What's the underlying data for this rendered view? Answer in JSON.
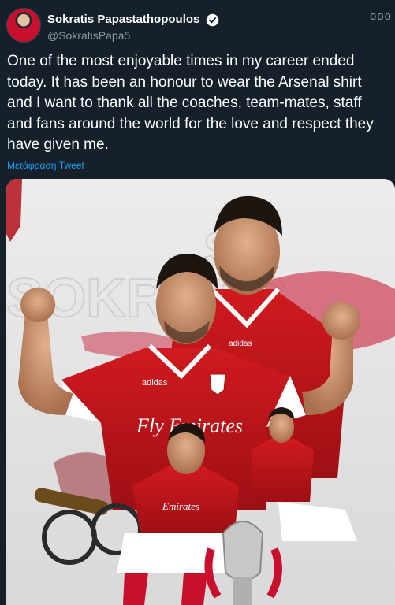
{
  "author": {
    "display_name": "Sokratis Papastathopoulos",
    "handle": "@SokratisPapa5",
    "verified_icon": "verified-badge-icon",
    "avatar_icon": "avatar-photo"
  },
  "tweet": {
    "text": "One of the most enjoyable times in my career ended today. It has been an honour to wear the Arsenal shirt and I want to thank all the coaches, team-mates, staff and fans around the world for the love and respect they have given me.",
    "translate_label": "Μετάφραση Tweet"
  },
  "menu": {
    "more_label": "ooo"
  },
  "media": {
    "shirt_text": "Fly Emirates",
    "shirt_brand": "adidas",
    "shirt_text_small": "Emirates",
    "watermark": "SOKRATIS"
  },
  "colors": {
    "background": "#15202b",
    "link": "#1da1f2",
    "secondary_text": "#8899a6",
    "arsenal_red": "#db0007"
  }
}
